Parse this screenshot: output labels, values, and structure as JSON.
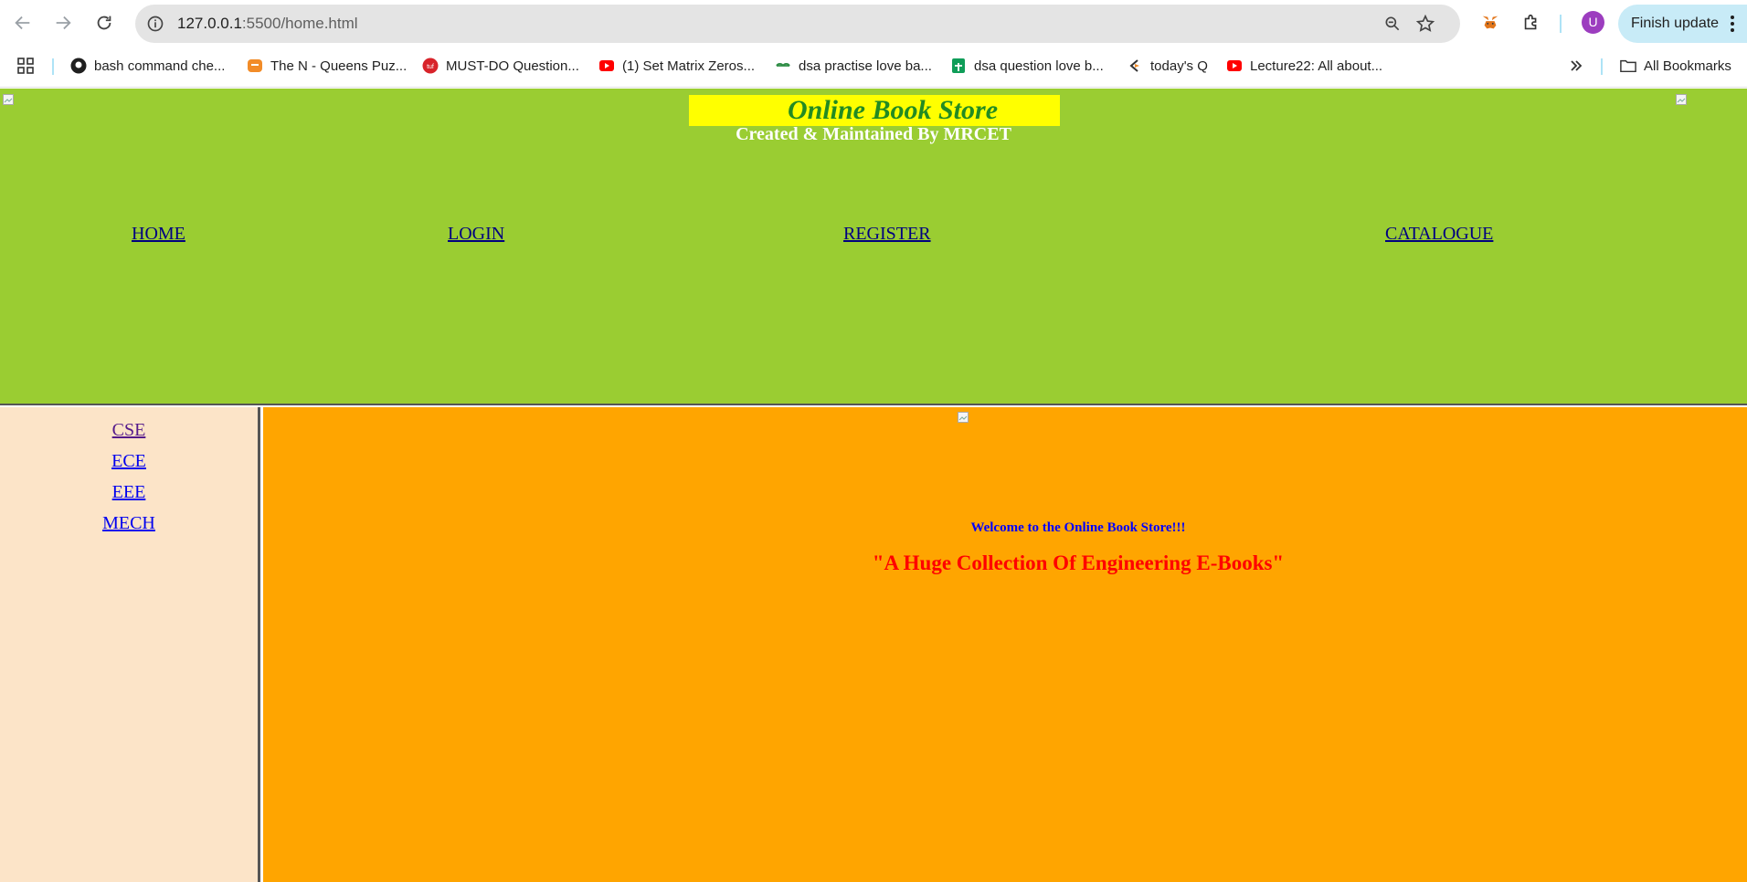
{
  "browser": {
    "url_host": "127.0.0.1",
    "url_rest": ":5500/home.html",
    "profile_initial": "U",
    "finish_update_label": "Finish update",
    "bookmarks": [
      {
        "label": "bash command che...",
        "icon": "github-icon"
      },
      {
        "label": "The N - Queens Puz...",
        "icon": "leetcode-icon"
      },
      {
        "label": "MUST-DO Question...",
        "icon": "tuf-icon"
      },
      {
        "label": "(1) Set Matrix Zeros...",
        "icon": "youtube-icon"
      },
      {
        "label": "dsa practise love ba...",
        "icon": "gfg-icon"
      },
      {
        "label": "dsa question love b...",
        "icon": "sheets-icon"
      },
      {
        "label": "today's Q",
        "icon": "codingninjas-icon"
      },
      {
        "label": "Lecture22: All about...",
        "icon": "youtube-icon"
      }
    ],
    "all_bookmarks_label": "All Bookmarks"
  },
  "header": {
    "title": "Online Book Store",
    "subtitle": "Created & Maintained By MRCET",
    "nav": [
      "HOME",
      "LOGIN",
      "REGISTER",
      "CATALOGUE"
    ]
  },
  "sidebar": {
    "links": [
      "CSE",
      "ECE",
      "EEE",
      "MECH"
    ]
  },
  "main": {
    "welcome": "Welcome to the Online Book Store!!!",
    "tagline": "\"A Huge Collection Of Engineering E-Books\""
  },
  "colors": {
    "header_bg": "#9acd32",
    "title_bg": "#ffff00",
    "title_text": "#228b22",
    "sidebar_bg": "#fce4c8",
    "main_bg": "#ffa500",
    "welcome_text": "#0000ff",
    "tagline_text": "#ff0000"
  }
}
